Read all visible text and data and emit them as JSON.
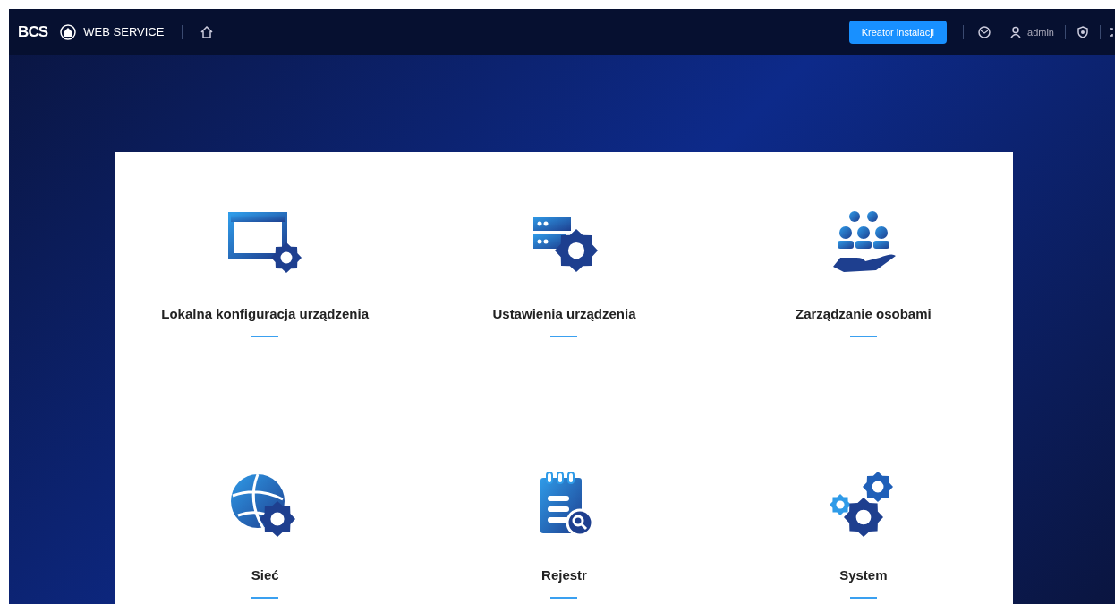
{
  "header": {
    "logo": "BCS",
    "app_name": "WEB SERVICE",
    "wizard_button": "Kreator instalacji",
    "user": "admin"
  },
  "tiles": [
    {
      "kind": "local",
      "label": "Lokalna konfiguracja urządzenia"
    },
    {
      "kind": "device",
      "label": "Ustawienia urządzenia"
    },
    {
      "kind": "people",
      "label": "Zarządzanie osobami"
    },
    {
      "kind": "network",
      "label": "Sieć"
    },
    {
      "kind": "log",
      "label": "Rejestr"
    },
    {
      "kind": "system",
      "label": "System"
    }
  ]
}
